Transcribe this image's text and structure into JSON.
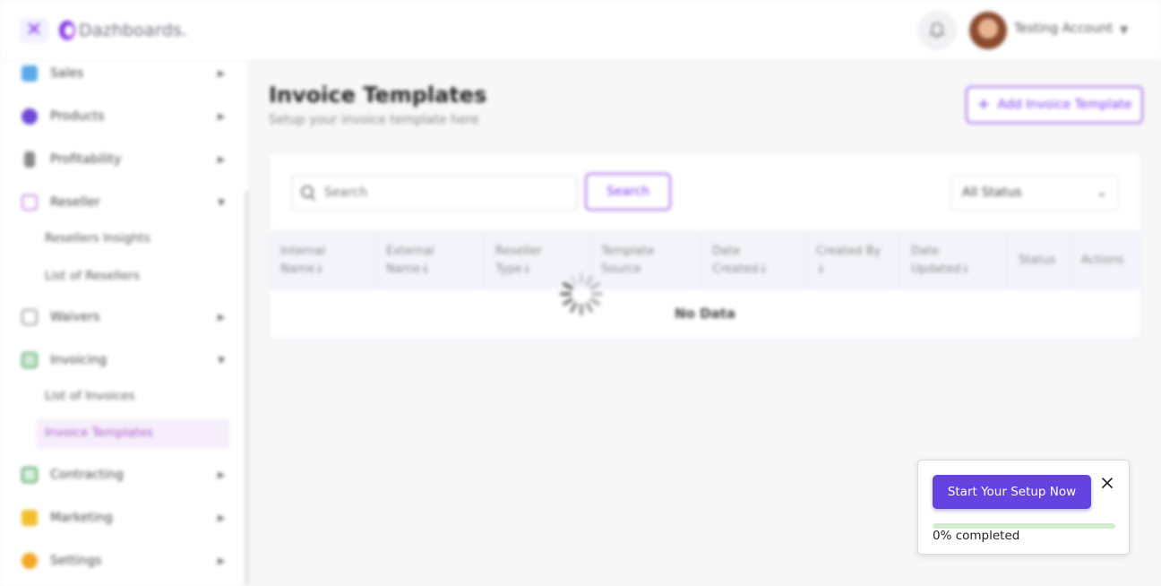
{
  "header": {
    "close_glyph": "✕",
    "logo_text": "Dazhboards.",
    "account_name": "Testing Account"
  },
  "sidebar": {
    "items": [
      {
        "label": "Sales",
        "icon": "chart-icon",
        "color": "#5aa9e6",
        "expanded": false
      },
      {
        "label": "Products",
        "icon": "cube-icon",
        "color": "#6c4ad6",
        "expanded": false
      },
      {
        "label": "Profitability",
        "icon": "lock-icon",
        "color": "#8a8a8a",
        "expanded": false
      },
      {
        "label": "Reseller",
        "icon": "inbox-icon",
        "color": "#c28ae0",
        "expanded": true
      },
      {
        "label": "Waivers",
        "icon": "clipboard-icon",
        "color": "#9a9a9a",
        "expanded": false
      },
      {
        "label": "Invoicing",
        "icon": "invoice-icon",
        "color": "#5aa86b",
        "expanded": true
      },
      {
        "label": "Contracting",
        "icon": "contract-icon",
        "color": "#4a9a5a",
        "expanded": false
      },
      {
        "label": "Marketing",
        "icon": "megaphone-icon",
        "color": "#f2c02e",
        "expanded": false
      },
      {
        "label": "Settings",
        "icon": "gear-icon",
        "color": "#f5a623",
        "expanded": false
      }
    ],
    "reseller_sub": [
      "Resellers Insights",
      "List of Resellers"
    ],
    "invoicing_sub": [
      "List of Invoices",
      "Invoice Templates"
    ],
    "active_sub": "Invoice Templates"
  },
  "main": {
    "title": "Invoice Templates",
    "subtitle": "Setup your invoice template here",
    "add_button": "Add Invoice Template",
    "search_placeholder": "Search",
    "search_button": "Search",
    "status_filter": "All Status",
    "columns": [
      "Internal Name↓",
      "External Name↓",
      "Reseller Type↓",
      "Template Source",
      "Date Created↓",
      "Created By ↓",
      "Date Updated↓",
      "Status",
      "Actions"
    ],
    "empty_text": "No Data"
  },
  "setup_widget": {
    "button_label": "Start Your Setup Now",
    "progress_percent": 0,
    "progress_text": "0% completed",
    "colors": {
      "button": "#6443e0",
      "track": "#d5ecd2",
      "fill": "#4caf50"
    }
  }
}
